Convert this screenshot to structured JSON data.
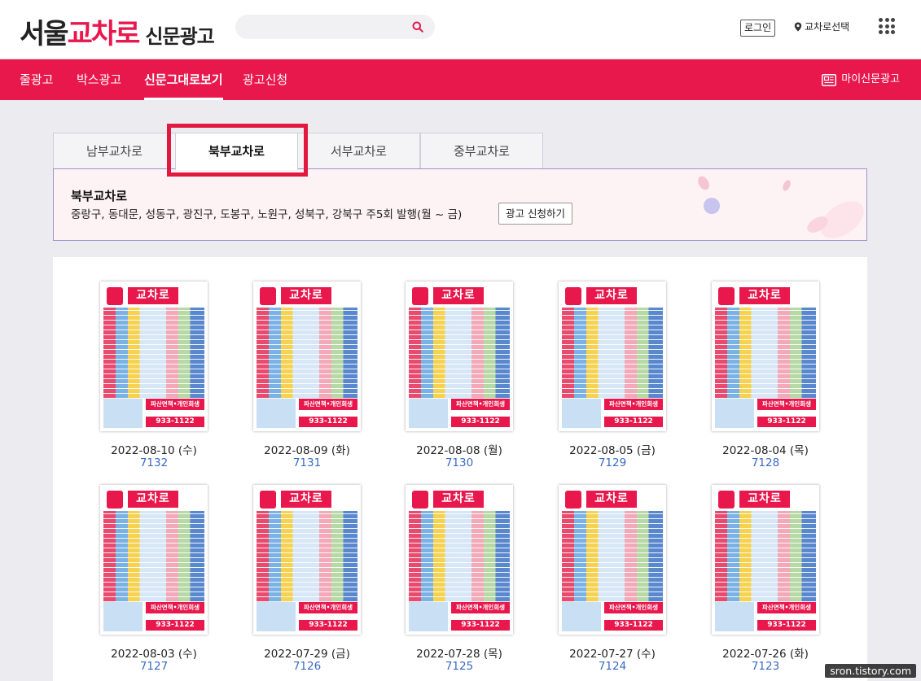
{
  "header": {
    "logo_main": "서울",
    "logo_accent": "교차로",
    "logo_sub": "신문광고",
    "search_placeholder": "",
    "login_label": "로그인",
    "region_label": "교차로선택"
  },
  "nav": {
    "items": [
      "줄광고",
      "박스광고",
      "신문그대로보기",
      "광고신청"
    ],
    "active_index": 2,
    "my_paper_label": "마이신문광고"
  },
  "tabs": {
    "items": [
      "남부교차로",
      "북부교차로",
      "서부교차로",
      "중부교차로"
    ],
    "active_index": 1
  },
  "region": {
    "title": "북부교차로",
    "description": "중랑구, 동대문, 성동구, 광진구, 도봉구, 노원구, 성북구, 강북구 주5회 발행(월 ~ 금)",
    "apply_label": "광고 신청하기"
  },
  "papers": [
    {
      "date": "2022-08-10 (수)",
      "issue": "7132"
    },
    {
      "date": "2022-08-09 (화)",
      "issue": "7131"
    },
    {
      "date": "2022-08-08 (월)",
      "issue": "7130"
    },
    {
      "date": "2022-08-05 (금)",
      "issue": "7129"
    },
    {
      "date": "2022-08-04 (목)",
      "issue": "7128"
    },
    {
      "date": "2022-08-03 (수)",
      "issue": "7127"
    },
    {
      "date": "2022-07-29 (금)",
      "issue": "7126"
    },
    {
      "date": "2022-07-28 (목)",
      "issue": "7125"
    },
    {
      "date": "2022-07-27 (수)",
      "issue": "7124"
    },
    {
      "date": "2022-07-26 (화)",
      "issue": "7123"
    }
  ],
  "thumbnail": {
    "brand": "교차로",
    "banner": "파산면책•개인회생",
    "phone": "933-1122"
  },
  "watermark": "sron.tistory.com",
  "colors": {
    "brand": "#e8184d",
    "highlight": "#e2193f",
    "link": "#3a6ac4"
  }
}
